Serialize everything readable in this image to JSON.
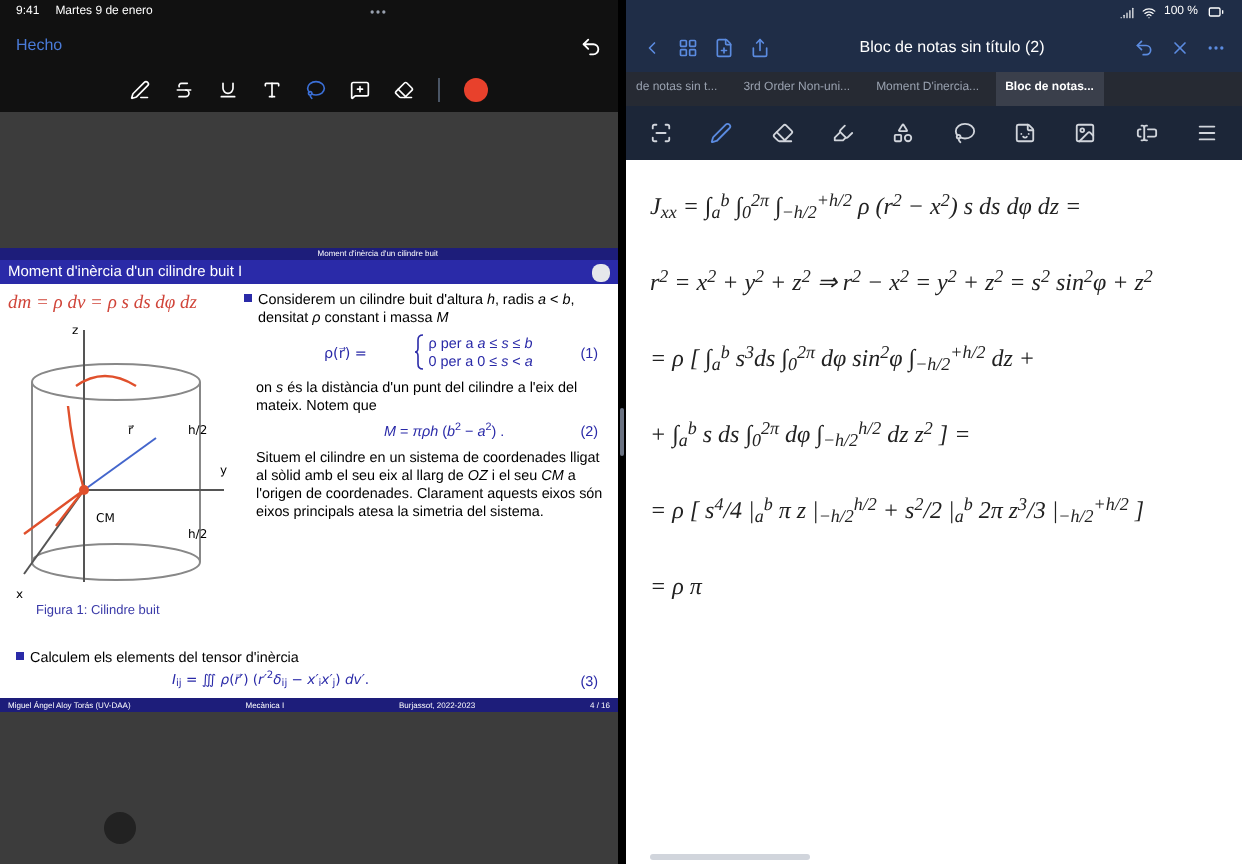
{
  "left_pane": {
    "status_bar": {
      "time": "9:41",
      "date": "Martes 9 de enero"
    },
    "done_button": "Hecho",
    "markup_tools": [
      {
        "kind": "pen",
        "selected": false
      },
      {
        "kind": "strikethrough",
        "selected": false
      },
      {
        "kind": "underline",
        "selected": false
      },
      {
        "kind": "text",
        "selected": false
      },
      {
        "kind": "lasso",
        "selected": true
      },
      {
        "kind": "comment",
        "selected": false
      },
      {
        "kind": "eraser",
        "selected": false
      }
    ],
    "slide": {
      "header": "Moment d'inèrcia d'un cilindre buit",
      "title": "Moment d'inèrcia d'un cilindre buit I",
      "annotation": "dm = ρ dv = ρ s ds dφ dz",
      "figure_labels": [
        {
          "kind": "z",
          "text": "z"
        },
        {
          "kind": "y",
          "text": "y"
        },
        {
          "kind": "x",
          "text": "x"
        },
        {
          "kind": "h_top",
          "text": "h/2"
        },
        {
          "kind": "h_bottom",
          "text": "h/2"
        },
        {
          "kind": "r",
          "text": "r⃗"
        },
        {
          "kind": "cm",
          "text": "CM"
        }
      ],
      "caption": "Figura 1: Cilindre buit",
      "bullet_1": "Considerem un cilindre buit d'altura *h*, radis *a* < *b*, densitat *ρ* constant i massa *M*",
      "eq_1": {
        "lhs": "ρ(r⃗) =",
        "case_1": "ρ per a *a* ≤ *s* ≤ *b*",
        "case_2": "0 per a 0 ≤ *s* < *a*",
        "number": "(1)"
      },
      "paragraph_1": "on *s* és la distància d'un punt del cilindre a l'eix del mateix. Notem que",
      "eq_2": {
        "formula": "*M* = *πρh* (*b*$^{2}$ − *a*$^{2}$) .",
        "number": "(2)"
      },
      "paragraph_2": "Situem el cilindre en un sistema de coordenades lligat al sòlid amb el seu eix al llarg de *OZ* i el seu *CM* a l'origen de coordenades. Clarament aquests eixos són eixos principals atesa la simetria del sistema.",
      "bullet_2": "Calculem els elements del tensor d'inèrcia",
      "eq_3": {
        "formula": "*I*$_{ij}$ = ∭ *ρ*(*r⃗′*) (*r′*$^{2}$*δ*$_{ij}$ − *x′*$_{i}$*x′*$_{j}$) *dv′*.",
        "number": "(3)"
      },
      "footer": [
        "Miguel Ángel Aloy Torás (UV-DAA)",
        "Mecànica I",
        "Burjassot, 2022-2023",
        "4 / 16"
      ]
    }
  },
  "right_pane": {
    "status_bar": {
      "battery": "100 %"
    },
    "title": "Bloc de notas sin título (2)",
    "tabs": [
      {
        "label": "de notas sin t...",
        "selected": false
      },
      {
        "label": "3rd Order Non-uni...",
        "selected": false
      },
      {
        "label": "Moment D'inercia...",
        "selected": false
      },
      {
        "label": "Bloc de notas...",
        "selected": true
      }
    ],
    "tools": [
      {
        "kind": "scan",
        "selected": false
      },
      {
        "kind": "pen",
        "selected": true
      },
      {
        "kind": "eraser",
        "selected": false
      },
      {
        "kind": "highlighter",
        "selected": false
      },
      {
        "kind": "shapes",
        "selected": false
      },
      {
        "kind": "lasso",
        "selected": false
      },
      {
        "kind": "sticker",
        "selected": false
      },
      {
        "kind": "image",
        "selected": false
      },
      {
        "kind": "textbox",
        "selected": false
      }
    ],
    "handwritten_lines": [
      "J$_{xx}$ = ∫$_{a}$$^{b}$ ∫$_{0}$$^{2π}$ ∫$_{−h/2}$$^{+h/2}$ ρ (r$^{2}$ − x$^{2}$) s ds dφ dz =",
      "r$^{2}$ = x$^{2}$ + y$^{2}$ + z$^{2}$ ⇒ r$^{2}$ − x$^{2}$ = y$^{2}$ + z$^{2}$ = s$^{2}$ sin$^{2}$φ + z$^{2}$",
      "= ρ [ ∫$_{a}$$^{b}$ s$^{3}$ds ∫$_{0}$$^{2π}$ dφ sin$^{2}$φ ∫$_{−h/2}$$^{+h/2}$ dz +",
      "+ ∫$_{a}$$^{b}$ s ds ∫$_{0}$$^{2π}$ dφ ∫$_{−h/2}$$^{h/2}$ dz z$^{2}$ ] =",
      "= ρ [ s$^{4}$/4 |$_{a}$$^{b}$ π z |$_{−h/2}$$^{h/2}$ + s$^{2}$/2 |$_{a}$$^{b}$ 2π z$^{3}$/3 |$_{−h/2}$$^{+h/2}$ ]",
      "= ρ π"
    ]
  }
}
